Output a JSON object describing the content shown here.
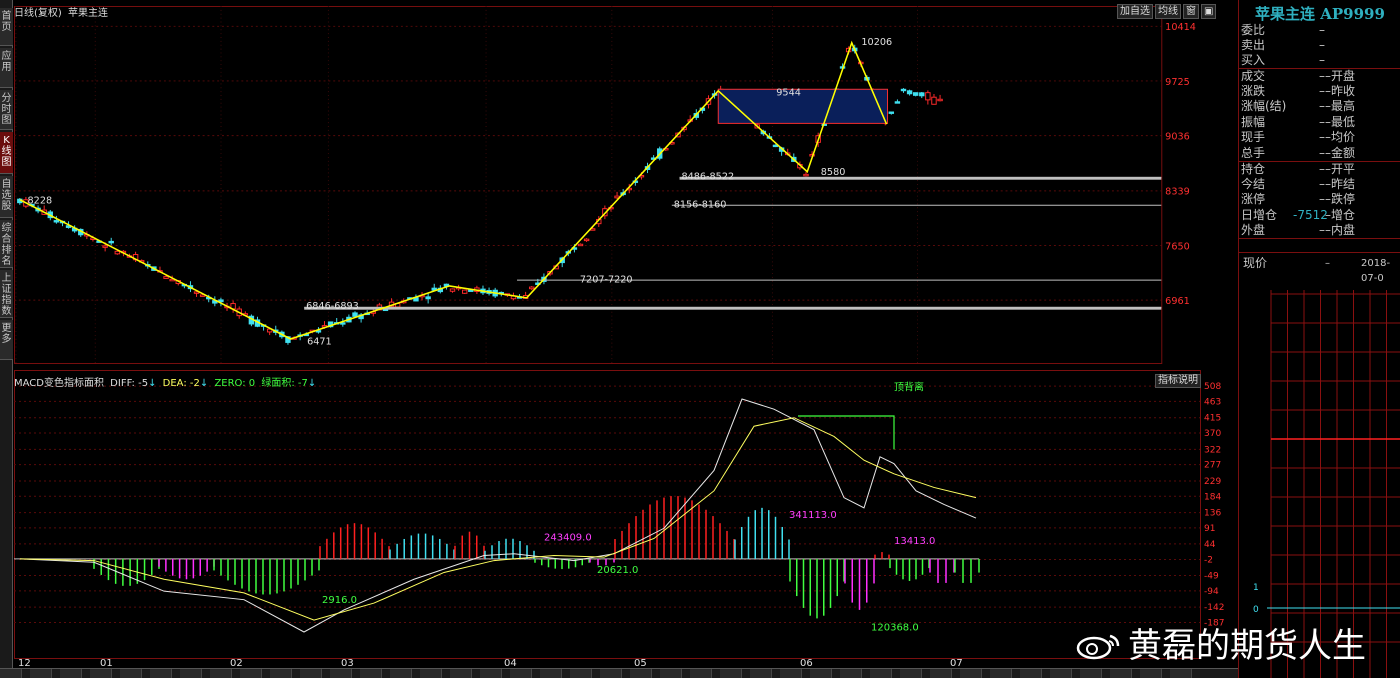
{
  "chart_header": {
    "period": "日线(复权)",
    "contract": "苹果主连"
  },
  "tool_buttons": [
    "加自选",
    "均线",
    "窗",
    "▣"
  ],
  "sidebar_tabs": [
    {
      "label": "首页",
      "active": false
    },
    {
      "label": "应用",
      "active": false
    },
    {
      "label": "分时图",
      "active": false
    },
    {
      "label": "K线图",
      "active": true
    },
    {
      "label": "自选股",
      "active": false
    },
    {
      "label": "综合排名",
      "active": false
    },
    {
      "label": "上证指数",
      "active": false
    },
    {
      "label": "更多",
      "active": false
    }
  ],
  "price_axis": {
    "ticks": [
      10414,
      9725,
      9036,
      8339,
      7650,
      6961
    ],
    "range": [
      6400,
      10450
    ]
  },
  "macd_axis": {
    "ticks": [
      508,
      463,
      415,
      370,
      322,
      277,
      229,
      184,
      136,
      91,
      44,
      -2,
      -49,
      -94,
      -142,
      -187
    ],
    "range": [
      -215,
      520
    ]
  },
  "time_axis": {
    "labels": [
      "12",
      "01",
      "02",
      "03",
      "04",
      "05",
      "06",
      "07"
    ]
  },
  "price_annotations": [
    "8228",
    "6471",
    "6846-6893",
    "7207-7220",
    "8156-8160",
    "8486-8522",
    "9544",
    "10206",
    "8580"
  ],
  "macd_header": {
    "name": "MACD变色指标面积",
    "diff": "DIFF: -5",
    "dea": "DEA: -2",
    "zero": "ZERO: 0",
    "green_area": "绿面积: -7"
  },
  "indicator_note": "指标说明",
  "macd_annotations": {
    "area_2916": "2916.0",
    "area_243409": "243409.0",
    "area_20621": "20621.0",
    "area_341113": "341113.0",
    "area_13413": "13413.0",
    "area_120368": "120368.0",
    "divergence": "顶背离"
  },
  "quote_panel": {
    "title": "苹果主连 AP9999",
    "rows": [
      {
        "l1": "委比",
        "v1": "–",
        "l2": "",
        "v2": ""
      },
      {
        "l1": "卖出",
        "v1": "–",
        "l2": "",
        "v2": ""
      },
      {
        "l1": "买入",
        "v1": "–",
        "l2": "",
        "v2": ""
      },
      {
        "l1": "成交",
        "v1": "–",
        "l2": "开盘",
        "v2": ""
      },
      {
        "l1": "涨跌",
        "v1": "–",
        "l2": "昨收",
        "v2": ""
      },
      {
        "l1": "涨幅(结)",
        "v1": "–",
        "l2": "最高",
        "v2": ""
      },
      {
        "l1": "振幅",
        "v1": "–",
        "l2": "最低",
        "v2": ""
      },
      {
        "l1": "现手",
        "v1": "–",
        "l2": "均价",
        "v2": ""
      },
      {
        "l1": "总手",
        "v1": "–",
        "l2": "金额",
        "v2": ""
      },
      {
        "l1": "持仓",
        "v1": "–",
        "l2": "开平",
        "v2": ""
      },
      {
        "l1": "今结",
        "v1": "–",
        "l2": "昨结",
        "v2": ""
      },
      {
        "l1": "涨停",
        "v1": "–",
        "l2": "跌停",
        "v2": ""
      },
      {
        "l1": "日增仓",
        "v1": "-7512",
        "l2": "增仓",
        "v2": ""
      },
      {
        "l1": "外盘",
        "v1": "–",
        "l2": "内盘",
        "v2": ""
      }
    ],
    "tick_row": {
      "label": "现价",
      "value": "–",
      "date": "2018-07-0"
    },
    "mini_axis": [
      "1",
      "0"
    ]
  },
  "watermark": "黄磊的期货人生",
  "colors": {
    "up": "#ff2a2a",
    "down": "#40e0f0",
    "zigzag": "#ffff00",
    "diff": "#e8e8e8",
    "dea": "#ffff60",
    "macd_pos_red": "#ff2020",
    "macd_pos_cyan": "#40e0f0",
    "macd_neg_green": "#40ff40",
    "macd_neg_magenta": "#ff30ff"
  }
}
